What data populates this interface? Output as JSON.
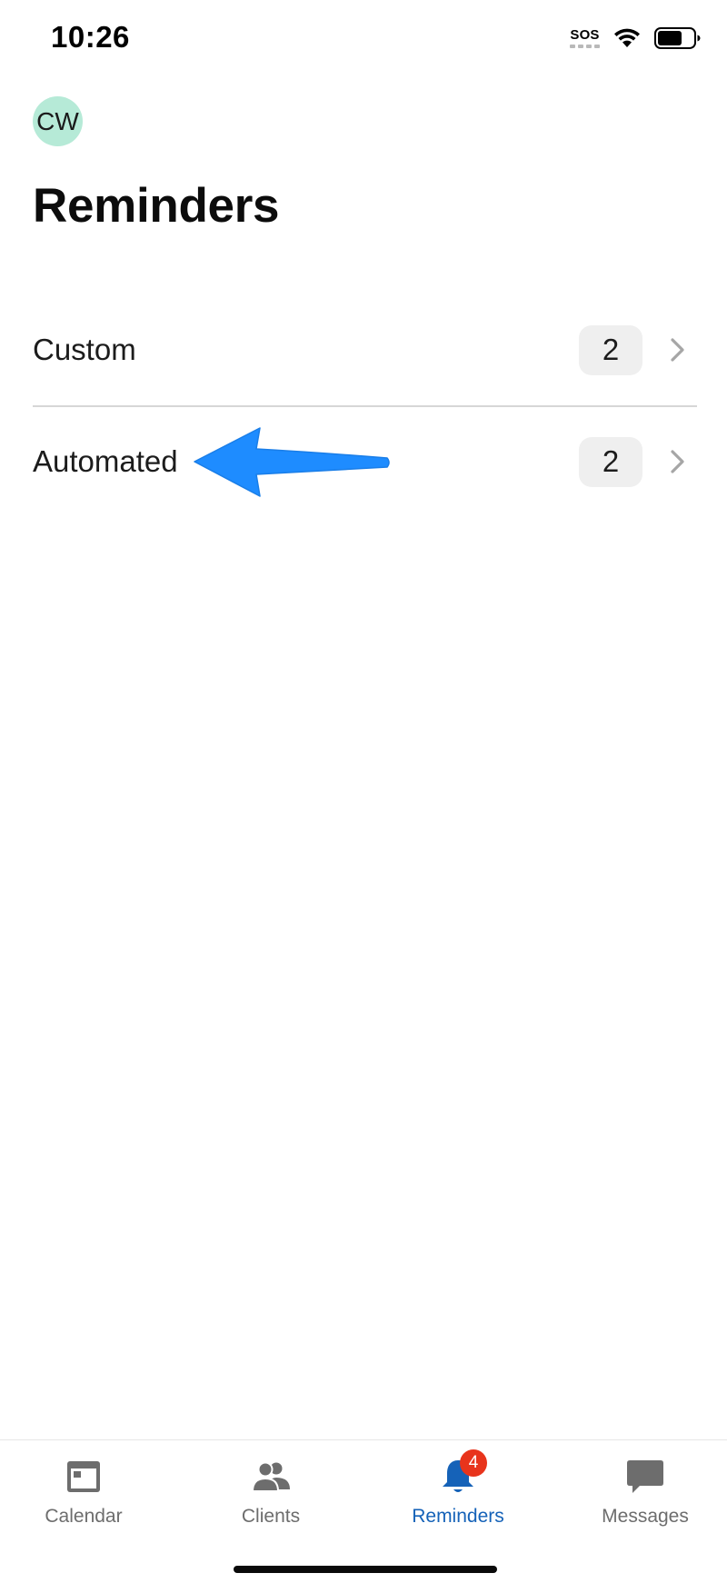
{
  "status_bar": {
    "time": "10:26",
    "sos_label": "SOS",
    "icons": [
      "wifi-icon",
      "battery-icon"
    ]
  },
  "header": {
    "avatar_initials": "CW",
    "avatar_color": "#b6ead7",
    "title": "Reminders"
  },
  "reminders": [
    {
      "label": "Custom",
      "count": "2",
      "icon": "chevron-right-icon"
    },
    {
      "label": "Automated",
      "count": "2",
      "icon": "chevron-right-icon"
    }
  ],
  "annotation": {
    "icon": "arrow-left-icon",
    "color": "#1e8cff"
  },
  "tab_bar": {
    "tabs": [
      {
        "label": "Calendar",
        "icon": "calendar-icon",
        "active": false
      },
      {
        "label": "Clients",
        "icon": "people-icon",
        "active": false
      },
      {
        "label": "Reminders",
        "icon": "bell-icon",
        "active": true,
        "badge": "4"
      },
      {
        "label": "Messages",
        "icon": "message-icon",
        "active": false
      }
    ],
    "active_color": "#1562b8",
    "inactive_color": "#6d6d6d",
    "badge_color": "#e8341c"
  }
}
